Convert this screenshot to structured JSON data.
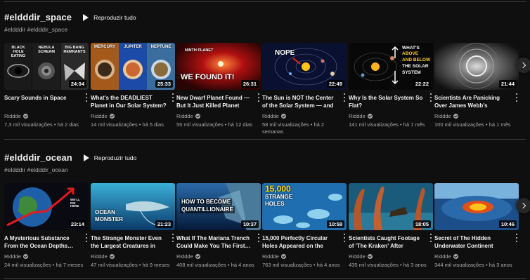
{
  "channel_name": "Riddde",
  "shelves": [
    {
      "title": "#eldddir_space",
      "subtitle": "#eldddir #eldddir_space",
      "play_all_label": "Reproduzir tudo",
      "videos": [
        {
          "title": "Scary Sounds in Space",
          "channel": "Riddde",
          "views": "7,3 mil visualizações",
          "age": "há 2 dias",
          "duration": "24:04",
          "thumb_text": [
            "BLACK HOLE EATING",
            "NEBULA SCREAM",
            "BIG BANG REMNANTS"
          ]
        },
        {
          "title": "What's the DEADLIEST Planet in Our Solar System?",
          "channel": "Riddde",
          "views": "14 mil visualizações",
          "age": "há 5 dias",
          "duration": "25:33",
          "thumb_text": [
            "MERCURY",
            "JUPITER",
            "NEPTUNE"
          ]
        },
        {
          "title": "New Dwarf Planet Found — But It Just Killed Planet Nine",
          "channel": "Riddde",
          "views": "55 mil visualizações",
          "age": "há 12 dias",
          "duration": "26:31",
          "thumb_text": [
            "NINTH PLANET",
            "WE FOUND IT!"
          ]
        },
        {
          "title": "The Sun is NOT the Center of the Solar System — and 8…",
          "channel": "Riddde",
          "views": "58 mil visualizações",
          "age": "há 2 semanas",
          "duration": "22:49",
          "thumb_text": [
            "NOPE"
          ]
        },
        {
          "title": "Why Is the Solar System So Flat?",
          "channel": "Riddde",
          "views": "141 mil visualizações",
          "age": "há 1 mês",
          "duration": "22:22",
          "thumb_text": [
            "WHAT'S",
            "ABOVE",
            "AND BELOW",
            "THE SOLAR",
            "SYSTEM"
          ]
        },
        {
          "title": "Scientists Are Panicking Over James Webb's Latest…",
          "channel": "Riddde",
          "views": "100 mil visualizações",
          "age": "há 1 mês",
          "duration": "21:44",
          "thumb_text": []
        }
      ]
    },
    {
      "title": "#eldddir_ocean",
      "subtitle": "#eldddir #eldddir_ocean",
      "play_all_label": "Reproduzir tudo",
      "videos": [
        {
          "title": "A Mysterious Substance From the Ocean Depths…",
          "channel": "Riddde",
          "views": "24 mil visualizações",
          "age": "há 7 meses",
          "duration": "23:14",
          "thumb_text": [
            "WE'LL DIE HERE"
          ]
        },
        {
          "title": "The Strange Monster Even the Largest Creatures in the…",
          "channel": "Riddde",
          "views": "47 mil visualizações",
          "age": "há 9 meses",
          "duration": "21:23",
          "thumb_text": [
            "OCEAN",
            "MONSTER"
          ]
        },
        {
          "title": "What If The Mariana Trench Could Make You The First…",
          "channel": "Riddde",
          "views": "408 mil visualizações",
          "age": "há 4 anos",
          "duration": "10:37",
          "thumb_text": [
            "HOW TO BECOME",
            "QUANTILLIONAIRE"
          ]
        },
        {
          "title": "15,000 Perfectly Circular Holes Appeared on the Oce…",
          "channel": "Riddde",
          "views": "763 mil visualizações",
          "age": "há 4 anos",
          "duration": "10:58",
          "thumb_text": [
            "15,000",
            "STRANGE",
            "HOLES"
          ]
        },
        {
          "title": "Scientists Caught Footage of 'The Kraken' After Centuries…",
          "channel": "Riddde",
          "views": "435 mil visualizações",
          "age": "há 3 anos",
          "duration": "18:05",
          "thumb_text": []
        },
        {
          "title": "Secret of The Hidden Underwater Continent",
          "channel": "Riddde",
          "views": "344 mil visualizações",
          "age": "há 3 anos",
          "duration": "10:46",
          "thumb_text": []
        }
      ]
    }
  ],
  "colors": {
    "background": "#0f0f0f",
    "text_primary": "#f1f1f1",
    "text_secondary": "#aaaaaa",
    "divider": "#3f3f3f"
  }
}
